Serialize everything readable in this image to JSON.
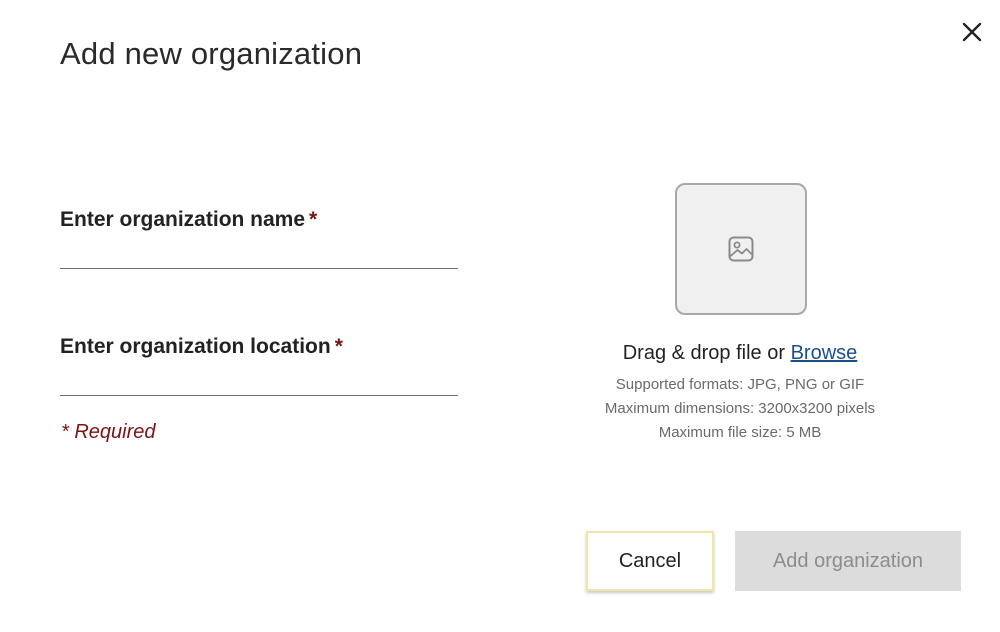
{
  "dialog": {
    "title": "Add new organization",
    "close_icon": "close-icon"
  },
  "form": {
    "name_label": "Enter organization name",
    "location_label": "Enter organization location",
    "asterisk": "*",
    "name_value": "",
    "location_value": "",
    "required_note": "* Required"
  },
  "upload": {
    "icon": "image-icon",
    "drag_text": "Drag & drop file or ",
    "browse_label": "Browse",
    "formats": "Supported formats: JPG, PNG or GIF",
    "dimensions": "Maximum dimensions: 3200x3200 pixels",
    "file_size": "Maximum file size: 5 MB"
  },
  "actions": {
    "cancel_label": "Cancel",
    "add_label": "Add organization"
  },
  "colors": {
    "required_accent": "#7a1515",
    "link": "#1a4f88",
    "disabled_button_bg": "#dcdcdc",
    "cancel_border": "#efe7a8"
  }
}
